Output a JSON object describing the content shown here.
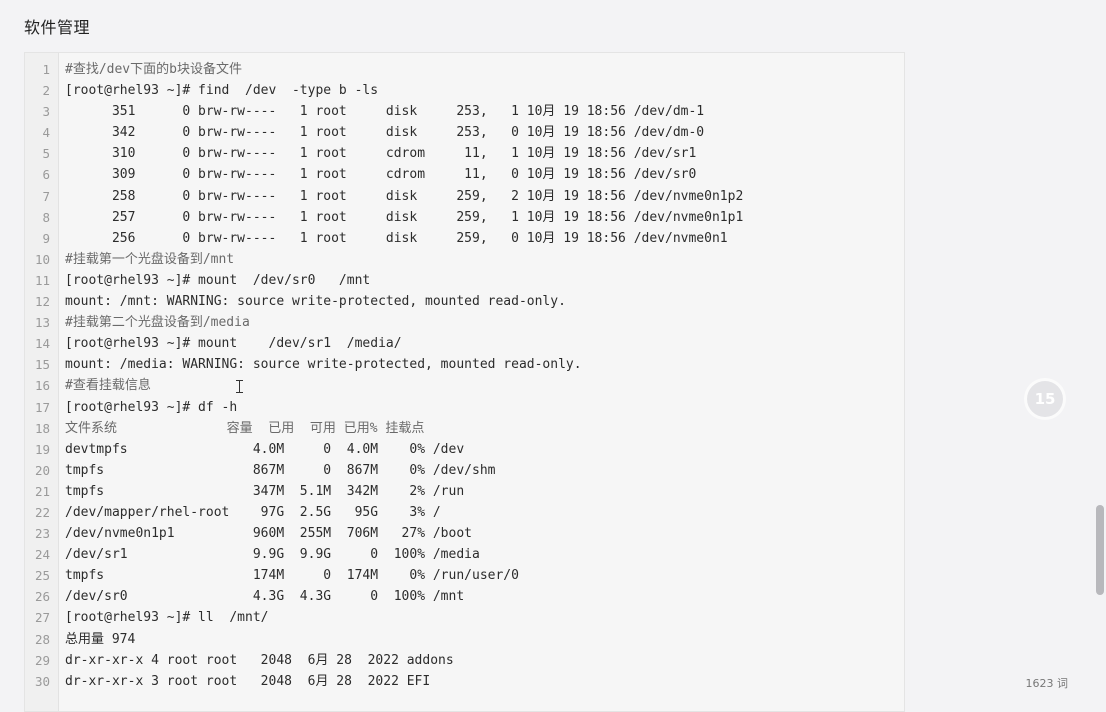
{
  "page": {
    "heading": "软件管理"
  },
  "code": {
    "lines": [
      {
        "n": "1",
        "t": "#查找/dev下面的b块设备文件",
        "c": true
      },
      {
        "n": "2",
        "t": "[root@rhel93 ~]# find  /dev  -type b -ls"
      },
      {
        "n": "3",
        "t": "      351      0 brw-rw----   1 root     disk     253,   1 10月 19 18:56 /dev/dm-1"
      },
      {
        "n": "4",
        "t": "      342      0 brw-rw----   1 root     disk     253,   0 10月 19 18:56 /dev/dm-0"
      },
      {
        "n": "5",
        "t": "      310      0 brw-rw----   1 root     cdrom     11,   1 10月 19 18:56 /dev/sr1"
      },
      {
        "n": "6",
        "t": "      309      0 brw-rw----   1 root     cdrom     11,   0 10月 19 18:56 /dev/sr0"
      },
      {
        "n": "7",
        "t": "      258      0 brw-rw----   1 root     disk     259,   2 10月 19 18:56 /dev/nvme0n1p2"
      },
      {
        "n": "8",
        "t": "      257      0 brw-rw----   1 root     disk     259,   1 10月 19 18:56 /dev/nvme0n1p1"
      },
      {
        "n": "9",
        "t": "      256      0 brw-rw----   1 root     disk     259,   0 10月 19 18:56 /dev/nvme0n1"
      },
      {
        "n": "10",
        "t": "#挂载第一个光盘设备到/mnt",
        "c": true
      },
      {
        "n": "11",
        "t": "[root@rhel93 ~]# mount  /dev/sr0   /mnt"
      },
      {
        "n": "12",
        "t": "mount: /mnt: WARNING: source write-protected, mounted read-only."
      },
      {
        "n": "13",
        "t": "#挂载第二个光盘设备到/media",
        "c": true
      },
      {
        "n": "14",
        "t": "[root@rhel93 ~]# mount    /dev/sr1  /media/"
      },
      {
        "n": "15",
        "t": "mount: /media: WARNING: source write-protected, mounted read-only."
      },
      {
        "n": "16",
        "t": "#查看挂载信息",
        "c": true
      },
      {
        "n": "17",
        "t": "[root@rhel93 ~]# df -h"
      },
      {
        "n": "18",
        "t": "文件系统              容量  已用  可用 已用% 挂载点",
        "c": true
      },
      {
        "n": "19",
        "t": "devtmpfs                4.0M     0  4.0M    0% /dev"
      },
      {
        "n": "20",
        "t": "tmpfs                   867M     0  867M    0% /dev/shm"
      },
      {
        "n": "21",
        "t": "tmpfs                   347M  5.1M  342M    2% /run"
      },
      {
        "n": "22",
        "t": "/dev/mapper/rhel-root    97G  2.5G   95G    3% /"
      },
      {
        "n": "23",
        "t": "/dev/nvme0n1p1          960M  255M  706M   27% /boot"
      },
      {
        "n": "24",
        "t": "/dev/sr1                9.9G  9.9G     0  100% /media"
      },
      {
        "n": "25",
        "t": "tmpfs                   174M     0  174M    0% /run/user/0"
      },
      {
        "n": "26",
        "t": "/dev/sr0                4.3G  4.3G     0  100% /mnt"
      },
      {
        "n": "27",
        "t": "[root@rhel93 ~]# ll  /mnt/"
      },
      {
        "n": "28",
        "t": "总用量 974"
      },
      {
        "n": "29",
        "t": "dr-xr-xr-x 4 root root   2048  6月 28  2022 addons"
      },
      {
        "n": "30",
        "t": "dr-xr-xr-x 3 root root   2048  6月 28  2022 EFI"
      }
    ]
  },
  "replay": {
    "label": "15"
  },
  "status": {
    "word_count": "1623 词"
  }
}
